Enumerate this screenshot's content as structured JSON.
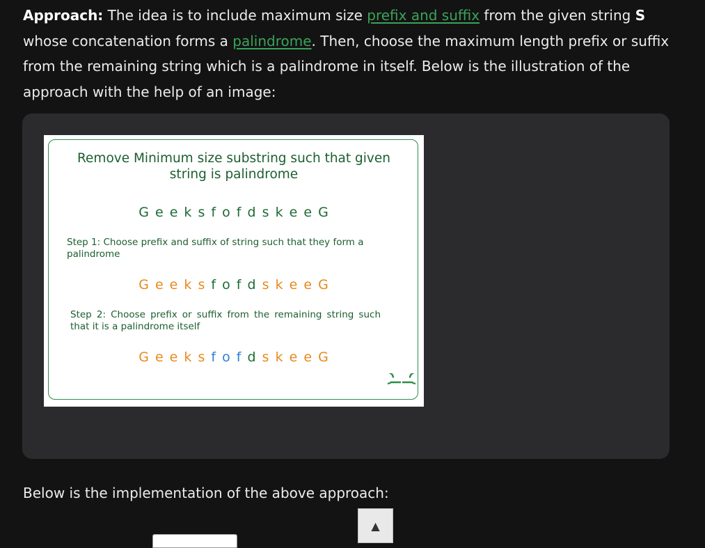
{
  "approach": {
    "label": "Approach:",
    "text1": " The idea is to include maximum size ",
    "link1": "prefix and suffix",
    "text2": " from the given string ",
    "strong_s": "S",
    "text3": " whose concatenation forms a ",
    "link2": "palindrome",
    "text4": ". Then, choose the maximum length prefix or suffix from the remaining string which is a palindrome in itself. Below is the illustration of the approach with the help of an image:"
  },
  "figure": {
    "title": "Remove Minimum size substring such that given string is palindrome",
    "string_row_1": [
      {
        "ch": "G e e k s f o f d s k e e G",
        "color": "green"
      }
    ],
    "step1": "Step 1: Choose prefix and suffix of string such that they form a palindrome",
    "string_row_2": [
      {
        "ch": "G e e k s",
        "color": "orange"
      },
      {
        "ch": " f o f d ",
        "color": "green"
      },
      {
        "ch": "s k e e G",
        "color": "orange"
      }
    ],
    "step2": "Step 2: Choose prefix or suffix from the remaining string such that it is a palindrome itself",
    "string_row_3": [
      {
        "ch": "G e e k s",
        "color": "orange"
      },
      {
        "ch": " f o f ",
        "color": "blue"
      },
      {
        "ch": "d ",
        "color": "green"
      },
      {
        "ch": "s k e e G",
        "color": "orange"
      }
    ],
    "logo": "gfg-logo",
    "colors": {
      "green": "#1c6b34",
      "orange": "#e8891b",
      "blue": "#2b7fd3"
    }
  },
  "implementation": {
    "text": "Below is the implementation of the above approach:"
  },
  "controls": {
    "scroll_up_icon": "▲"
  }
}
